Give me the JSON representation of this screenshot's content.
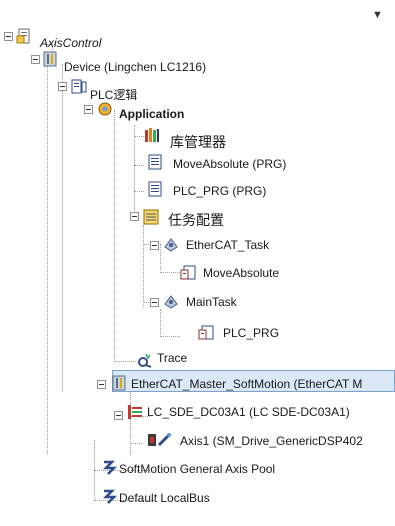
{
  "tree": {
    "dropdown_glyph": "▼",
    "nodes": [
      {
        "key": "axiscontrol",
        "label": "AxisControl",
        "icon": "project-icon"
      },
      {
        "key": "device",
        "label": "Device (Lingchen LC1216)",
        "icon": "device-icon"
      },
      {
        "key": "plc",
        "label": "PLC逻辑",
        "icon": "plc-logic-icon"
      },
      {
        "key": "application",
        "label": "Application",
        "icon": "application-icon"
      },
      {
        "key": "library",
        "label": "库管理器",
        "icon": "library-icon"
      },
      {
        "key": "moveabsolute_prg",
        "label": "MoveAbsolute (PRG)",
        "icon": "pou-icon"
      },
      {
        "key": "plc_prg",
        "label": "PLC_PRG (PRG)",
        "icon": "pou-icon"
      },
      {
        "key": "task_config",
        "label": "任务配置",
        "icon": "task-config-icon"
      },
      {
        "key": "ethercat_task",
        "label": "EtherCAT_Task",
        "icon": "task-icon"
      },
      {
        "key": "moveabsolute_call",
        "label": "MoveAbsolute",
        "icon": "pou-call-icon"
      },
      {
        "key": "maintask",
        "label": "MainTask",
        "icon": "task-icon"
      },
      {
        "key": "plc_prg_call",
        "label": "PLC_PRG",
        "icon": "pou-call-icon"
      },
      {
        "key": "trace",
        "label": "Trace",
        "icon": "trace-icon"
      },
      {
        "key": "ethercat_master",
        "label": "EtherCAT_Master_SoftMotion (EtherCAT M",
        "icon": "device-icon"
      },
      {
        "key": "lc_sde",
        "label": "LC_SDE_DC03A1 (LC SDE-DC03A1)",
        "icon": "drive-icon"
      },
      {
        "key": "axis1",
        "label": "Axis1 (SM_Drive_GenericDSP402",
        "icon": "axis-icon"
      },
      {
        "key": "softmotion_pool",
        "label": "SoftMotion General Axis Pool",
        "icon": "axis-pool-icon"
      },
      {
        "key": "localbus",
        "label": "Default LocalBus",
        "icon": "localbus-icon"
      }
    ]
  },
  "colors": {
    "selection_bg": "#dbe8f7",
    "selection_border": "#7da2ce",
    "tree_line": "#a0a0a0"
  }
}
